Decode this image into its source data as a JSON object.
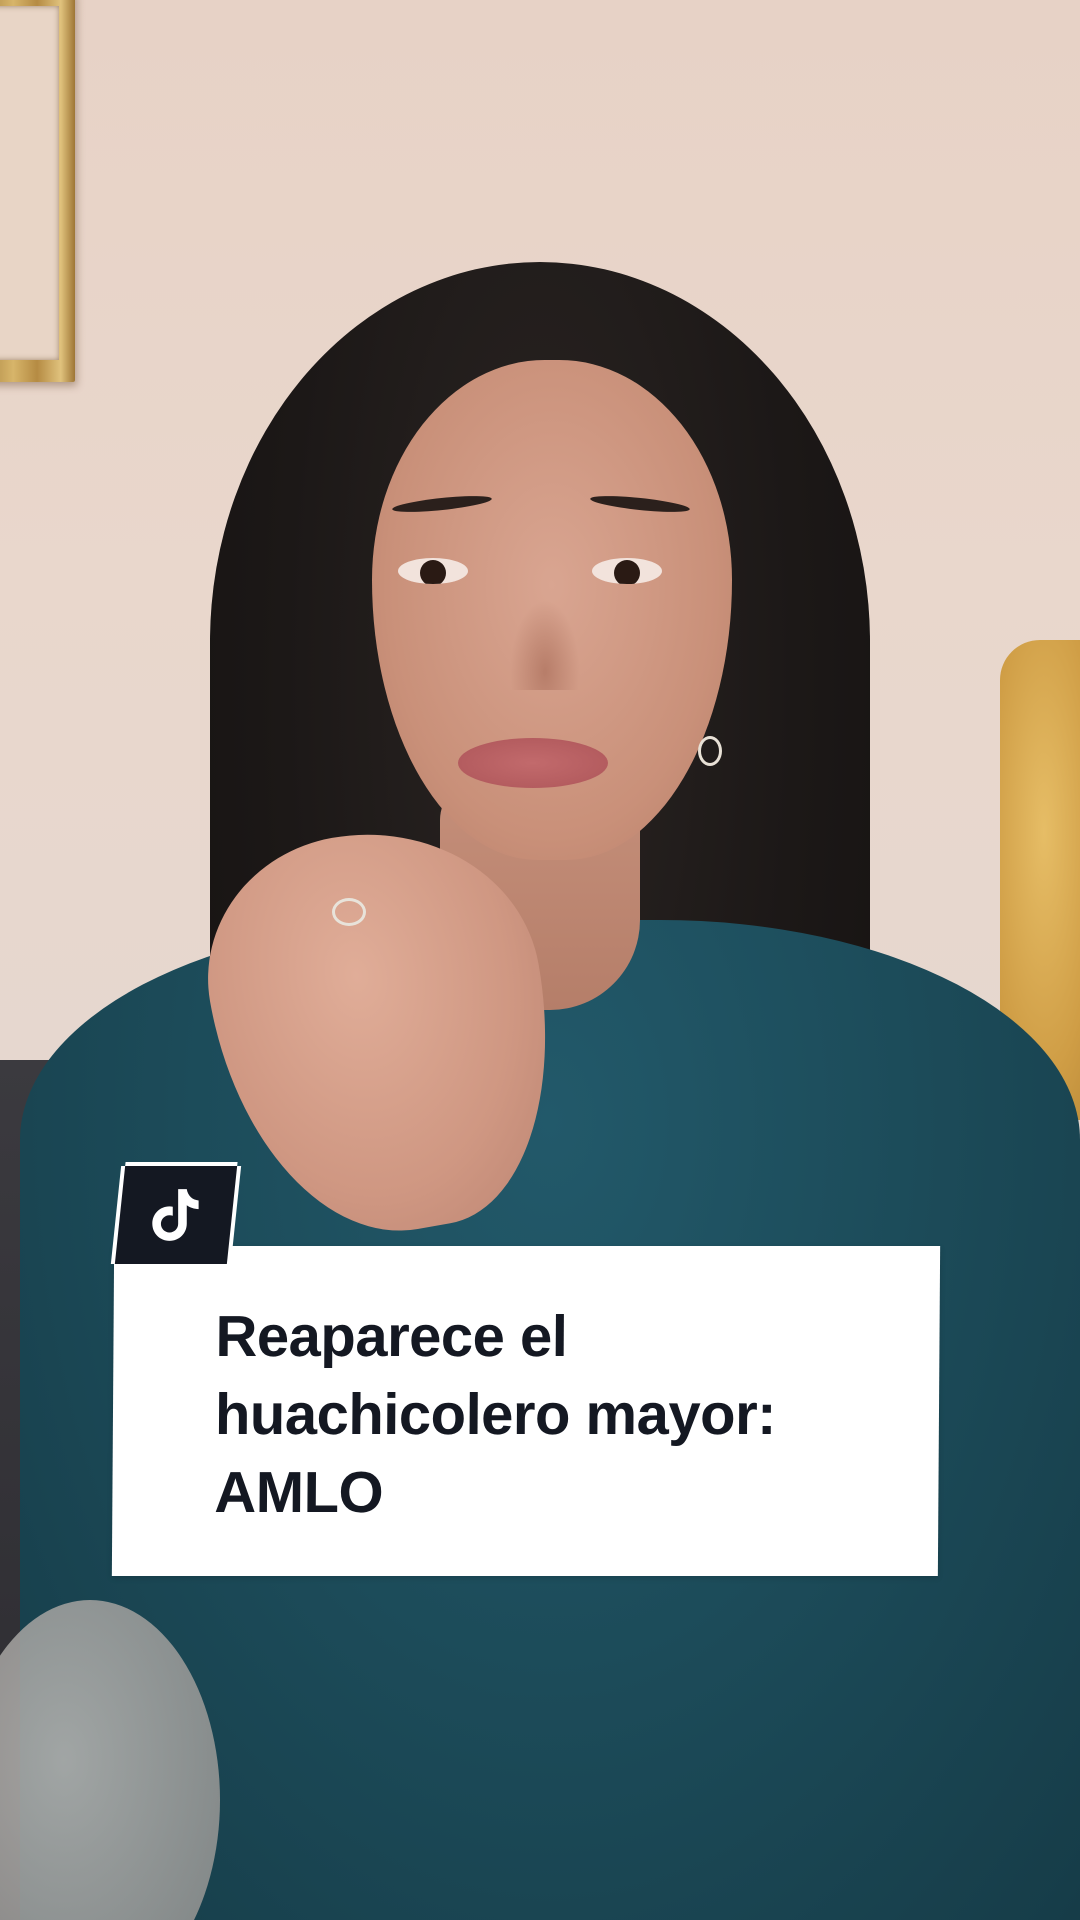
{
  "video": {
    "scene": "woman-speaking-to-camera",
    "brand_icon": "tiktok-logo-icon",
    "caption": {
      "line1": "Reaparece el",
      "line2": "huachicolero mayor:",
      "line3": "AMLO"
    }
  },
  "colors": {
    "caption_background": "#ffffff",
    "caption_text": "#141822",
    "badge_background": "#141822",
    "jacket": "#1c4b59",
    "wall": "#e7d2c6"
  }
}
